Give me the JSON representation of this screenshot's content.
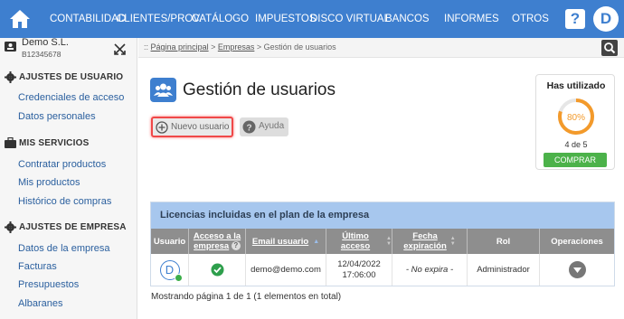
{
  "topbar": {
    "nav": [
      "CONTABILIDAD",
      "CLIENTES/PROV.",
      "CATÁLOGO",
      "IMPUESTOS",
      "DISCO VIRTUAL",
      "BANCOS",
      "INFORMES",
      "OTROS"
    ],
    "help_label": "?",
    "avatar_letter": "D",
    "color": "#3e7fcf"
  },
  "company": {
    "name": "Demo S.L.",
    "id": "B12345678"
  },
  "sidebar": {
    "sections": [
      {
        "title": "AJUSTES DE USUARIO",
        "icon": "gear-icon",
        "items": [
          "Credenciales de acceso",
          "Datos personales"
        ]
      },
      {
        "title": "MIS SERVICIOS",
        "icon": "briefcase-icon",
        "items": [
          "Contratar productos",
          "Mis productos",
          "Histórico de compras"
        ]
      },
      {
        "title": "AJUSTES DE EMPRESA",
        "icon": "gear-icon",
        "items": [
          "Datos de la empresa",
          "Facturas",
          "Presupuestos",
          "Albaranes"
        ]
      }
    ]
  },
  "breadcrumb": {
    "prefix": "::",
    "items": [
      "Página principal",
      "Empresas",
      "Gestión de usuarios"
    ]
  },
  "page": {
    "title": "Gestión de usuarios",
    "new_user": "Nuevo usuario",
    "help": "Ayuda"
  },
  "usage": {
    "title": "Has utilizado",
    "percent": "80%",
    "fraction": 0.8,
    "count": "4 de 5",
    "buy": "COMPRAR",
    "ring_color": "#f39a2b",
    "buy_color": "#4cb24a"
  },
  "table": {
    "title": "Licencias incluidas en el plan de la empresa",
    "headers": {
      "usuario": "Usuario",
      "acceso_1": "Acceso a la",
      "acceso_2": "empresa",
      "email": "Email usuario",
      "ultimo": "Último acceso",
      "fecha_1": "Fecha",
      "fecha_2": "expiración",
      "rol": "Rol",
      "operaciones": "Operaciones"
    },
    "row": {
      "avatar": "D",
      "email": "demo@demo.com",
      "date": "12/04/2022",
      "time": "17:06:00",
      "expira": "- No expira -",
      "rol": "Administrador"
    },
    "footer": "Mostrando página 1 de 1 (1 elementos en total)"
  }
}
